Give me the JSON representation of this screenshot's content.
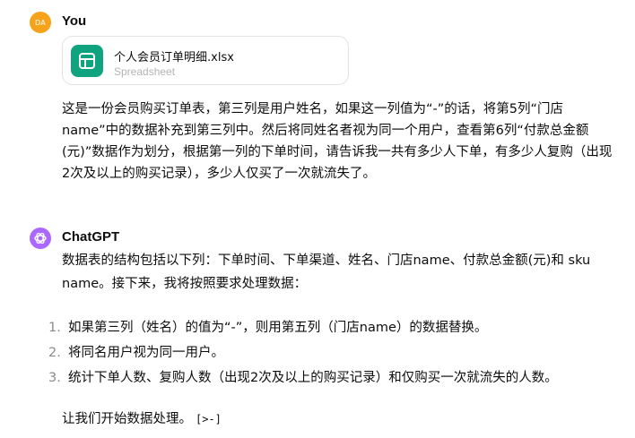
{
  "user": {
    "avatar_initials": "DA",
    "name": "You",
    "attachment": {
      "filename": "个人会员订单明细.xlsx",
      "type": "Spreadsheet",
      "icon": "spreadsheet-icon"
    },
    "message": "这是一份会员购买订单表，第三列是用户姓名，如果这一列值为“-”的话，将第5列“门店name”中的数据补充到第三列中。然后将同姓名者视为同一个用户，查看第6列“付款总金额(元)”数据作为划分，根据第一列的下单时间，请告诉我一共有多少人下单，有多少人复购（出现2次及以上的购买记录），多少人仅买了一次就流失了。"
  },
  "assistant": {
    "name": "ChatGPT",
    "intro": "数据表的结构包括以下列：下单时间、下单渠道、姓名、门店name、付款总金额(元)和 sku name。接下来，我将按照要求处理数据：",
    "steps": [
      {
        "num": "1.",
        "text": "如果第三列（姓名）的值为“-”，则用第五列（门店name）的数据替换。"
      },
      {
        "num": "2.",
        "text": "将同名用户视为同一用户。"
      },
      {
        "num": "3.",
        "text": "统计下单人数、复购人数（出现2次及以上的购买记录）和仅购买一次就流失的人数。"
      }
    ],
    "outro": "让我们开始数据处理。",
    "code_indicator": "[>-]"
  },
  "colors": {
    "user_avatar": "#f7a21b",
    "assistant_avatar": "#ab68ff",
    "spreadsheet_icon_bg": "#10a37f"
  }
}
